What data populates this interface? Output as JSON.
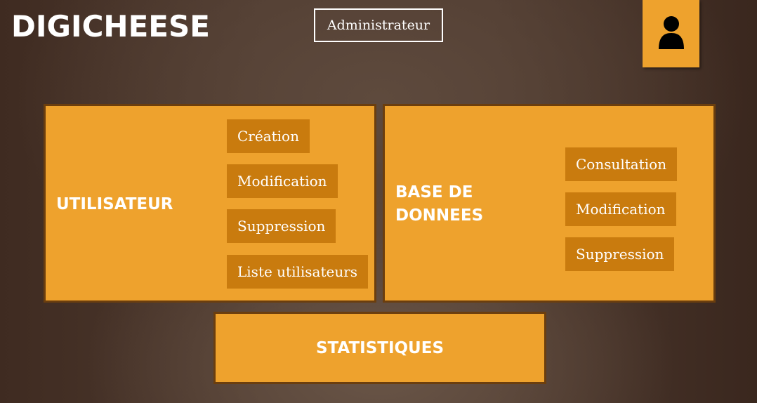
{
  "app": {
    "title": "DIGICHEESE"
  },
  "header": {
    "role_label": "Administrateur",
    "user_icon": "user-account-icon"
  },
  "panels": {
    "users": {
      "title": "UTILISATEUR",
      "actions": [
        "Création",
        "Modification",
        "Suppression",
        "Liste utilisateurs"
      ]
    },
    "database": {
      "title": "BASE DE DONNEES",
      "actions": [
        "Consultation",
        "Modification",
        "Suppression"
      ]
    },
    "stats": {
      "title": "STATISTIQUES"
    }
  },
  "colors": {
    "panel": "#eea22d",
    "panel_border": "#6b3e0e",
    "action": "#c97b0e",
    "background": "#4e3a2f"
  }
}
